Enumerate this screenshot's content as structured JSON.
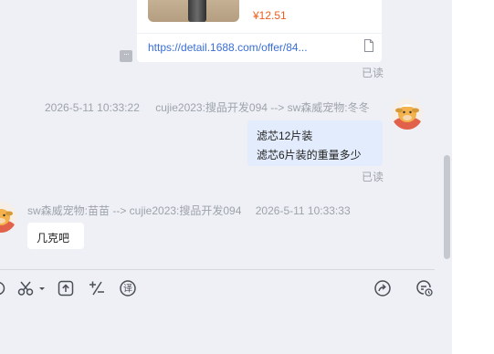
{
  "product_card": {
    "price": "¥12.51",
    "link_text": "https://detail.1688.com/offer/84..."
  },
  "read_status_1": "已读",
  "message_out": {
    "timestamp": "2026-5-11 10:33:22",
    "sender": "cujie2023:搜品开发094 --> sw森威宠物:冬冬",
    "lines": [
      "滤芯12片装",
      "滤芯6片装的重量多少"
    ],
    "read_status": "已读"
  },
  "message_in": {
    "sender": "sw森威宠物:苗苗 --> cujie2023:搜品开发094",
    "timestamp": "2026-5-11 10:33:33",
    "text": "几克吧"
  },
  "toolbar": {
    "left_tools": [
      "partial-tool-icon",
      "scissors-icon",
      "dropdown-caret-icon",
      "upload-icon",
      "quick-phrase-icon",
      "translate-icon"
    ],
    "right_tools": [
      "forward-icon",
      "history-icon"
    ],
    "translate_glyph": "译"
  },
  "colors": {
    "panel_bg": "#eef0f5",
    "outgoing_bubble": "#e3ecfc",
    "incoming_bubble": "#ffffff",
    "price": "#f35b1d",
    "link": "#3a6fd8",
    "meta_text": "#9ea3ab"
  }
}
